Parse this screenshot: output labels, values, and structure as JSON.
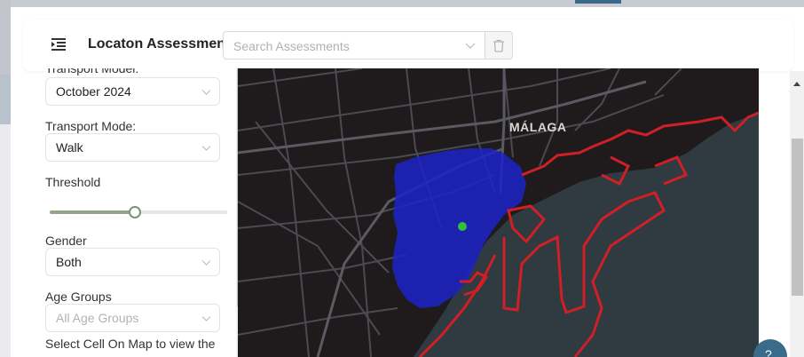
{
  "header": {
    "title": "Locaton Assessment",
    "search_placeholder": "Search Assessments"
  },
  "sidebar": {
    "transport_model": {
      "label": "Transport Model:",
      "value": "October 2024"
    },
    "transport_mode": {
      "label": "Transport Mode:",
      "value": "Walk"
    },
    "threshold": {
      "label": "Threshold",
      "level_percent": 48
    },
    "gender": {
      "label": "Gender",
      "value": "Both"
    },
    "age_groups": {
      "label": "Age Groups",
      "placeholder": "All Age Groups"
    },
    "hint": "Select Cell On Map to view the"
  },
  "map": {
    "city_label": "MÁLAGA",
    "colors": {
      "background": "#1f1b1c",
      "roads": "#4a4a52",
      "sea": "#2f3a41",
      "coverage": "#1c22c8",
      "boundary": "#d01f25",
      "marker": "#2fbf3a"
    }
  },
  "icons": {
    "menu": "menu-fold-icon",
    "chevron": "chevron-down-icon",
    "delete": "trash-icon",
    "chat": "help-chat-icon"
  },
  "chat_glyph": "?"
}
